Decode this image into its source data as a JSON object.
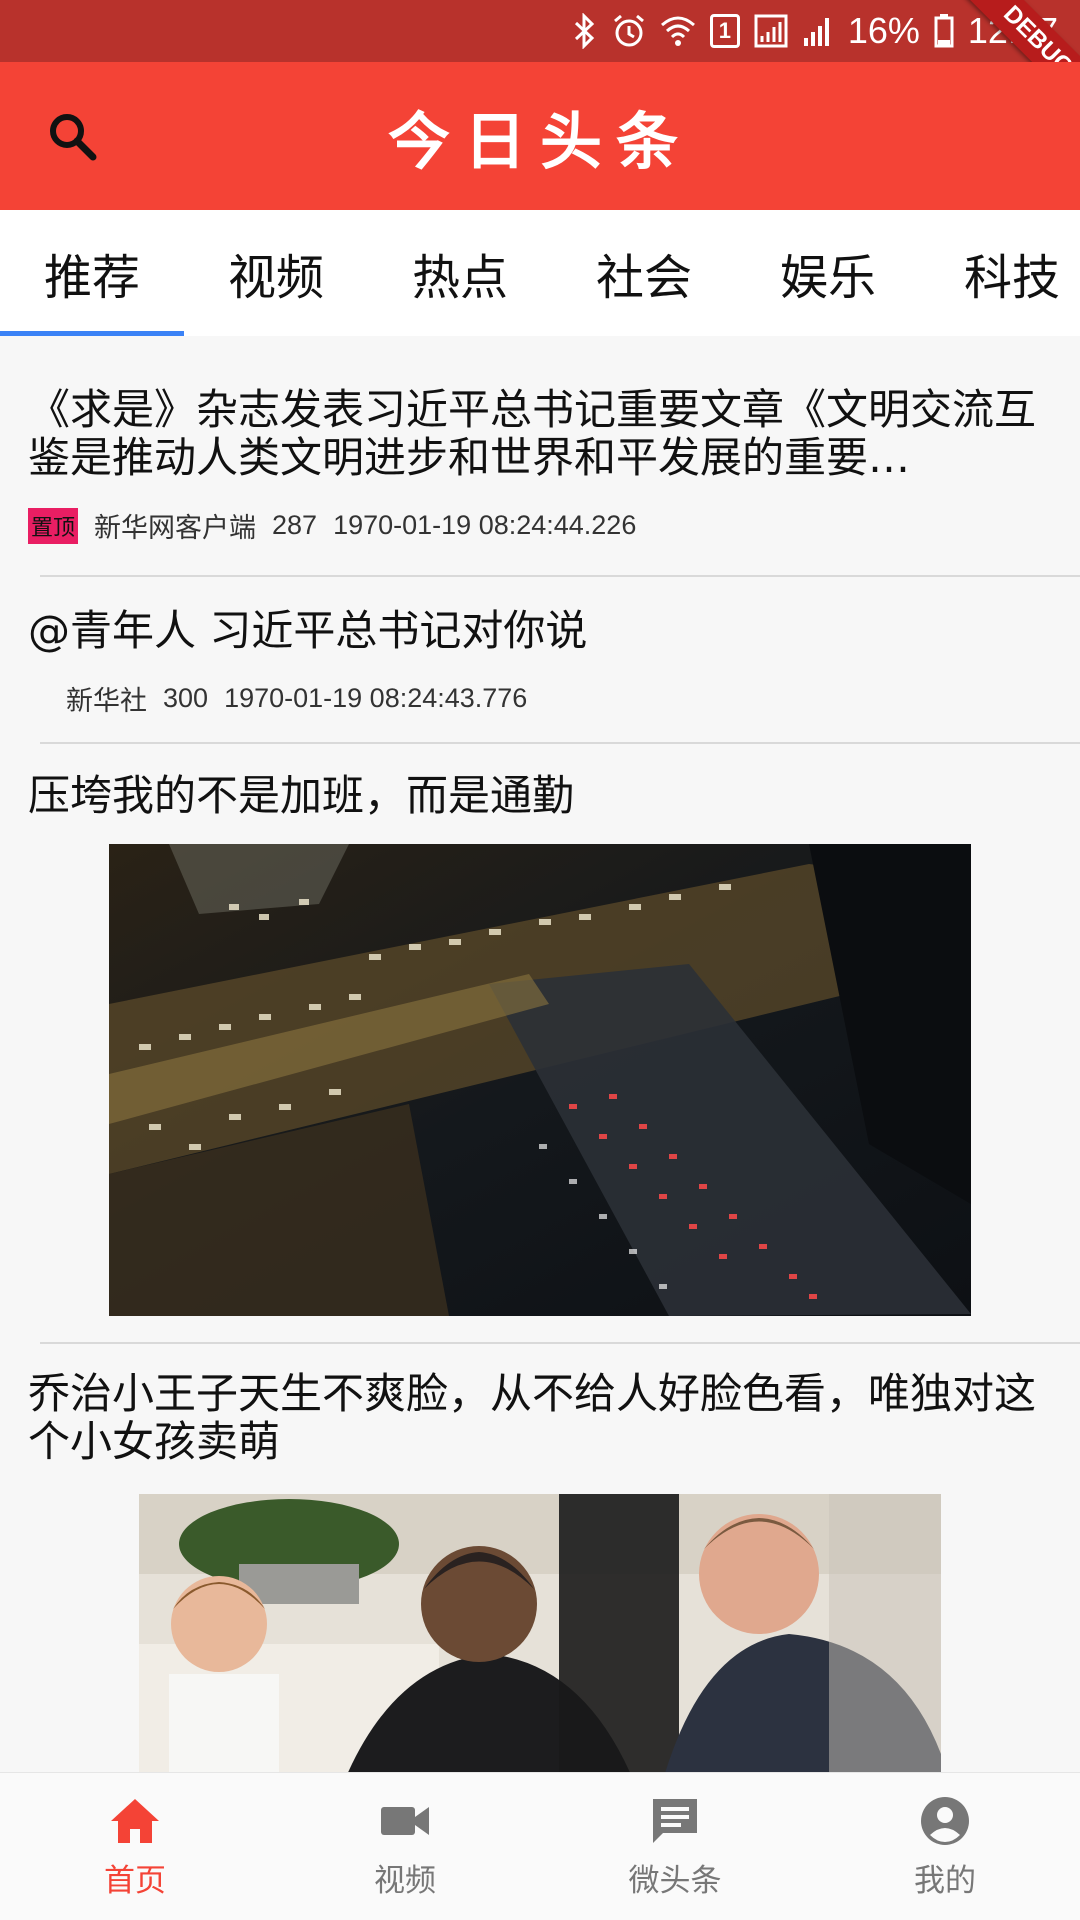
{
  "status_bar": {
    "battery": "16%",
    "time": "12:17",
    "sim_slot": "1",
    "debug_label": "DEBUG"
  },
  "app_bar": {
    "title": "今日头条"
  },
  "tabs": [
    {
      "label": "推荐"
    },
    {
      "label": "视频"
    },
    {
      "label": "热点"
    },
    {
      "label": "社会"
    },
    {
      "label": "娱乐"
    },
    {
      "label": "科技"
    }
  ],
  "feed": [
    {
      "title": "《求是》杂志发表习近平总书记重要文章《文明交流互鉴是推动人类文明进步和世界和平发展的重要…",
      "badge": "置顶",
      "source": "新华网客户端",
      "comments": "287",
      "time": "1970-01-19 08:24:44.226"
    },
    {
      "title": "@青年人 习近平总书记对你说",
      "source": "新华社",
      "comments": "300",
      "time": "1970-01-19 08:24:43.776"
    },
    {
      "title": "压垮我的不是加班，而是通勤"
    },
    {
      "title": "乔治小王子天生不爽脸，从不给人好脸色看，唯独对这个小女孩卖萌"
    }
  ],
  "bottom_nav": [
    {
      "label": "首页",
      "icon": "home-icon"
    },
    {
      "label": "视频",
      "icon": "videocam-icon"
    },
    {
      "label": "微头条",
      "icon": "chat-icon"
    },
    {
      "label": "我的",
      "icon": "account-icon"
    }
  ],
  "colors": {
    "primary": "#f44336",
    "status_bar": "#b8322c",
    "tab_indicator": "#3b82f6",
    "badge": "#e91e63"
  }
}
